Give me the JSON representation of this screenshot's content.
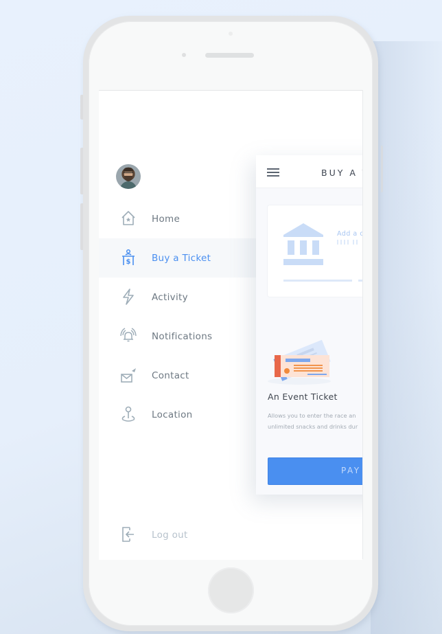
{
  "drawer": {
    "user_avatar": "user-avatar-photo",
    "items": [
      {
        "label": "Home",
        "icon": "home-star-icon",
        "active": false
      },
      {
        "label": "Buy a Ticket",
        "icon": "ticket-counter-icon",
        "active": true
      },
      {
        "label": "Activity",
        "icon": "lightning-icon",
        "active": false
      },
      {
        "label": "Notifications",
        "icon": "bell-ringing-icon",
        "active": false
      },
      {
        "label": "Contact",
        "icon": "mail-send-icon",
        "active": false
      },
      {
        "label": "Location",
        "icon": "map-pin-icon",
        "active": false
      }
    ],
    "logout": {
      "label": "Log out",
      "icon": "logout-icon"
    }
  },
  "panel": {
    "menu_icon": "hamburger-icon",
    "title": "BUY A T",
    "bank_card": {
      "icon": "bank-icon",
      "add_text": "Add a c"
    },
    "ticket": {
      "illustration": "event-ticket-illustration",
      "title": "An Event Ticket",
      "desc_line1": "Allows you to enter the race an",
      "desc_line2": "unlimited snacks and drinks dur"
    },
    "pay_button": "PAY"
  },
  "colors": {
    "accent": "#4a8ff0",
    "text_muted": "#6d7882",
    "active_bg": "#f6f8fa",
    "ticket_orange": "#f08a3c",
    "ticket_red": "#e8684a"
  }
}
